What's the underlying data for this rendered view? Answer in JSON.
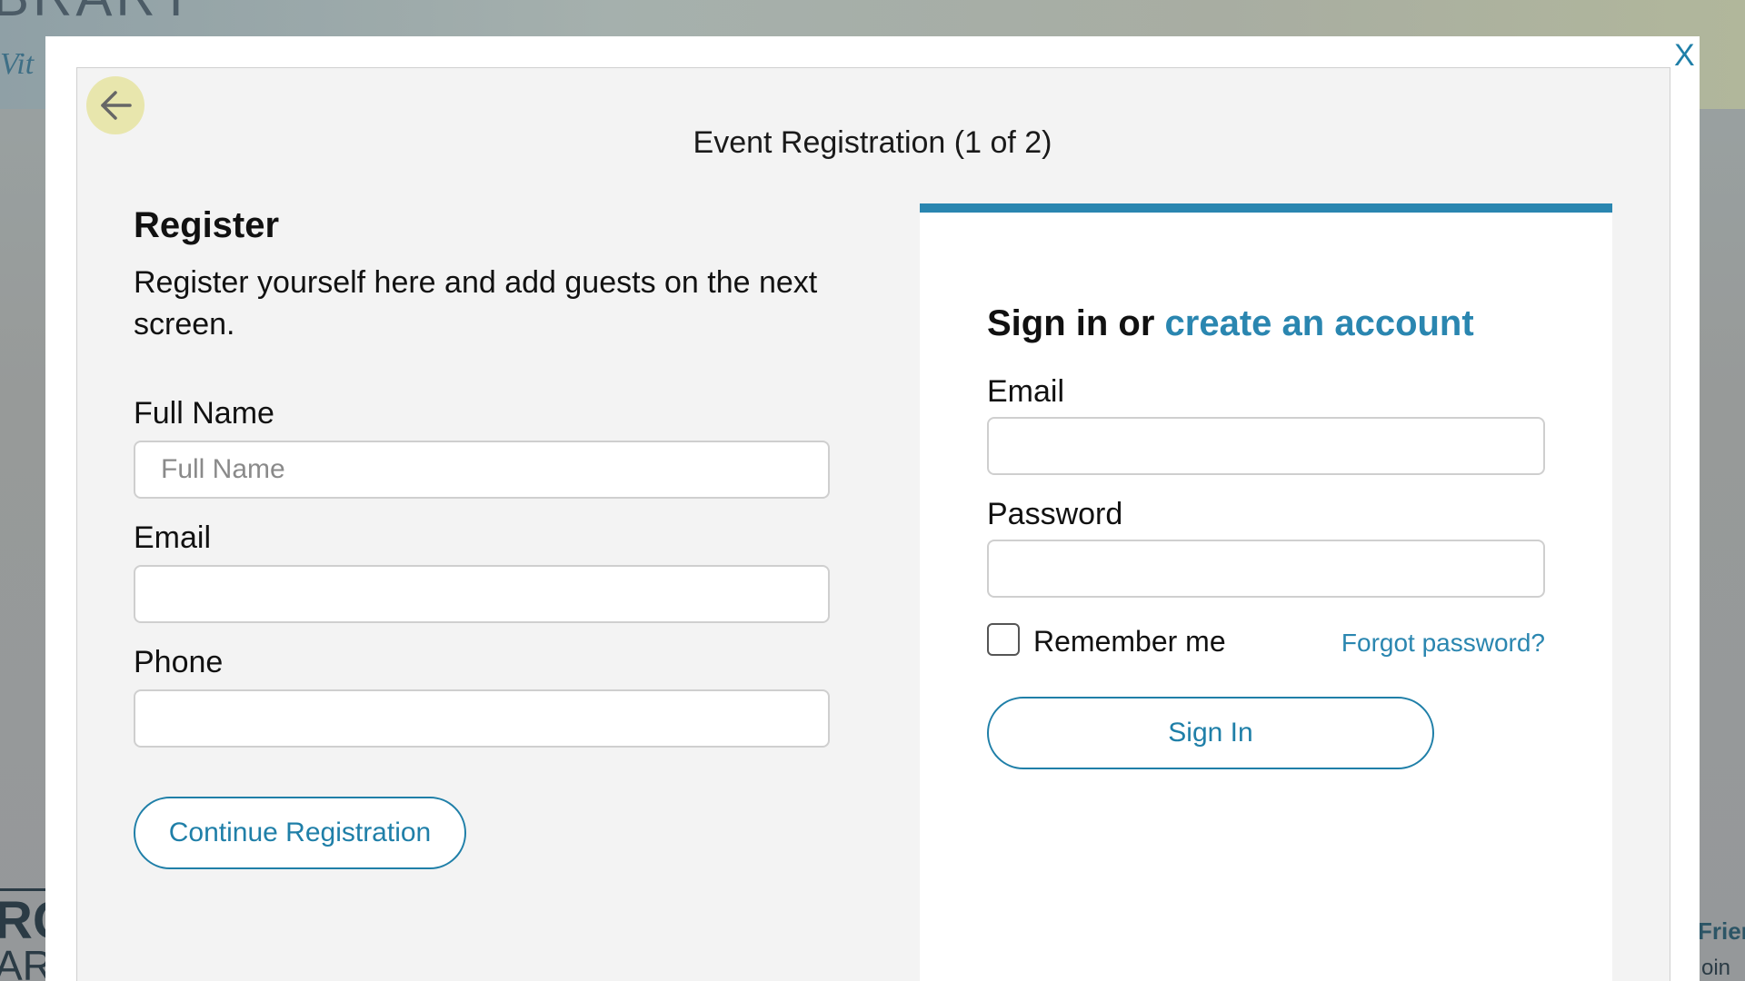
{
  "background": {
    "logo_fragment": "BRARY",
    "tagline_fragment": "Vit",
    "bottom_left_line1": "RG",
    "bottom_left_line2": "AR",
    "bottom_right_line1": "Frien",
    "bottom_right_line2": "oin"
  },
  "modal": {
    "close_label": "X",
    "title": "Event Registration (1 of 2)"
  },
  "register": {
    "heading": "Register",
    "description": "Register yourself here and add guests on the next screen.",
    "full_name_label": "Full Name",
    "full_name_placeholder": "Full Name",
    "full_name_value": "",
    "email_label": "Email",
    "email_value": "",
    "phone_label": "Phone",
    "phone_value": "",
    "continue_label": "Continue Registration"
  },
  "signin": {
    "heading_prefix": "Sign in or ",
    "create_account_label": "create an account",
    "email_label": "Email",
    "email_value": "",
    "password_label": "Password",
    "password_value": "",
    "remember_label": "Remember me",
    "remember_checked": false,
    "forgot_label": "Forgot password?",
    "sign_in_label": "Sign In"
  },
  "colors": {
    "accent": "#2a86b0",
    "back_button_bg": "#e8e6ad",
    "panel_bg": "#f3f3f3"
  },
  "icons": {
    "back": "arrow-left-icon"
  }
}
